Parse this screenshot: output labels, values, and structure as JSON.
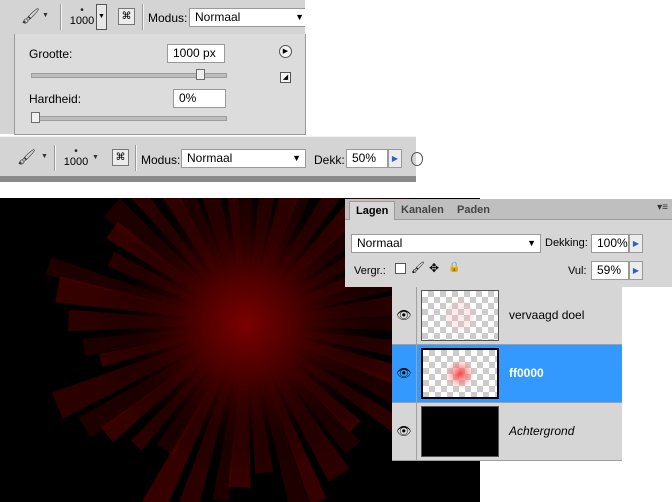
{
  "toolbar1": {
    "brush_size": "1000",
    "mode_label": "Modus:",
    "mode_value": "Normaal",
    "icons": [
      "brush-icon",
      "dropdown-arrow-icon",
      "brush-panel-icon"
    ]
  },
  "brush_popup": {
    "size_label": "Grootte:",
    "size_value": "1000 px",
    "size_slider": 0.87,
    "hardness_label": "Hardheid:",
    "hardness_value": "0%",
    "hardness_slider": 0.0
  },
  "toolbar2": {
    "brush_size": "1000",
    "mode_label": "Modus:",
    "mode_value": "Normaal",
    "opacity_label": "Dekk:",
    "opacity_value": "50%"
  },
  "layers_panel": {
    "tabs": [
      {
        "label": "Lagen",
        "active": true
      },
      {
        "label": "Kanalen",
        "active": false
      },
      {
        "label": "Paden",
        "active": false
      }
    ],
    "blend_mode": "Normaal",
    "opacity_label": "Dekking:",
    "opacity_value": "100%",
    "lock_label": "Vergr.:",
    "fill_label": "Vul:",
    "fill_value": "59%",
    "layers": [
      {
        "name": "vervaagd doel",
        "selected": false,
        "italic": false
      },
      {
        "name": "ff0000",
        "selected": true,
        "italic": false
      },
      {
        "name": "Achtergrond",
        "selected": false,
        "italic": true
      }
    ]
  },
  "colors": {
    "accent_selected": "#3399ff",
    "canvas_bg": "#000000",
    "glow": "#7a0000"
  }
}
